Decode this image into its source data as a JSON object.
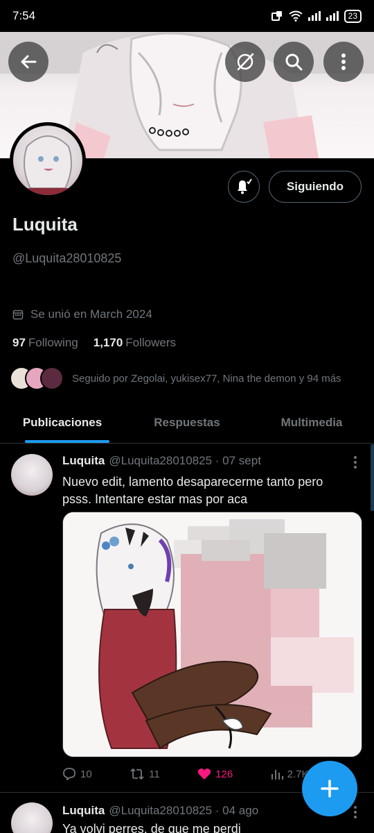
{
  "status_bar": {
    "time": "7:54",
    "battery": "23"
  },
  "profile": {
    "name": "Luquita",
    "handle": "@Luquita28010825",
    "joined": "Se unió en March 2024",
    "following_count": "97",
    "following_label": "Following",
    "followers_count": "1,170",
    "followers_label": "Followers",
    "followed_by": "Seguido por Zegolai, yukisex77, Nina the demon y 94 más",
    "follow_button": "Siguiendo"
  },
  "tabs": [
    {
      "label": "Publicaciones"
    },
    {
      "label": "Respuestas"
    },
    {
      "label": "Multimedia"
    }
  ],
  "tweets": [
    {
      "name": "Luquita",
      "meta": "@Luquita28010825 · 07 sept",
      "text": "Nuevo edit, lamento desaparecerme tanto pero psss. Intentare estar mas por aca",
      "replies": "10",
      "retweets": "11",
      "likes": "126",
      "views": "2.7K"
    },
    {
      "name": "Luquita",
      "meta": "@Luquita28010825 · 04 ago",
      "text": "Ya volvi perres, de que me perdi"
    }
  ],
  "colors": {
    "accent": "#1d9bf0",
    "like": "#f91880",
    "muted": "#71767b"
  }
}
